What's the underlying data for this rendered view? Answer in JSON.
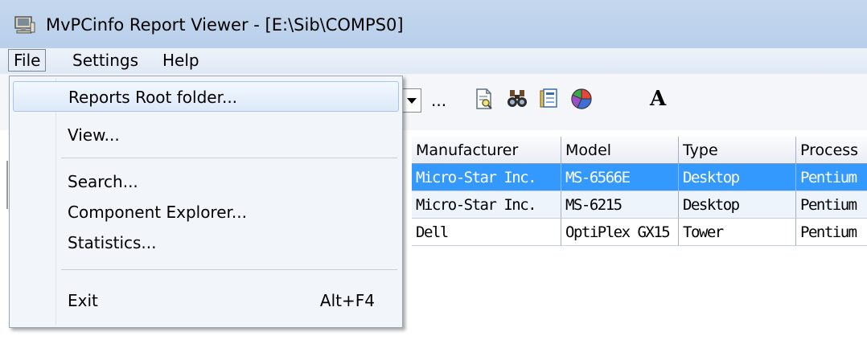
{
  "window": {
    "title": "MvPCinfo Report Viewer - [E:\\Sib\\COMPS0]",
    "icon": "computer-app-icon"
  },
  "menubar": {
    "items": [
      {
        "label": "File",
        "active": true
      },
      {
        "label": "Settings",
        "active": false
      },
      {
        "label": "Help",
        "active": false
      }
    ]
  },
  "toolbar": {
    "ellipsis_label": "...",
    "font_label": "A",
    "icons": [
      "report-view-icon",
      "binoculars-icon",
      "component-explorer-icon",
      "statistics-pie-icon",
      "font-icon"
    ]
  },
  "file_menu": {
    "items": [
      {
        "label": "Reports Root folder...",
        "shortcut": ""
      },
      {
        "label": "View...",
        "shortcut": ""
      },
      {
        "label": "Search...",
        "shortcut": ""
      },
      {
        "label": "Component Explorer...",
        "shortcut": ""
      },
      {
        "label": "Statistics...",
        "shortcut": ""
      },
      {
        "label": "Exit",
        "shortcut": "Alt+F4"
      }
    ]
  },
  "grid": {
    "columns": [
      "Manufacturer",
      "Model",
      "Type",
      "Process"
    ],
    "rows": [
      [
        "Micro-Star Inc.",
        "MS-6566E",
        "Desktop",
        "Pentium"
      ],
      [
        "Micro-Star Inc.",
        "MS-6215",
        "Desktop",
        "Pentium"
      ],
      [
        "Dell",
        "OptiPlex GX15",
        "Tower",
        "Pentium"
      ]
    ]
  },
  "colors": {
    "selection": "#3399ff",
    "titlebar": "#c4d7ee"
  }
}
